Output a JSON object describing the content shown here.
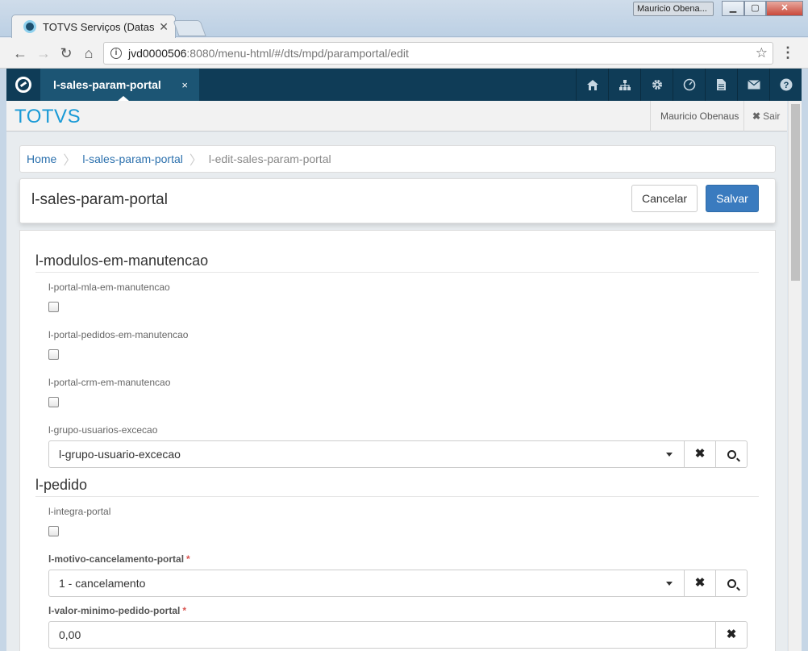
{
  "window": {
    "tab_title": "TOTVS Serviços (Datasul",
    "user_badge": "Mauricio Obena...",
    "min_label": "▁",
    "max_label": "▢",
    "close_label": "✕"
  },
  "address_bar": {
    "host": "jvd0000506",
    "path": ":8080/menu-html/#/dts/mpd/paramportal/edit"
  },
  "app": {
    "tab_label": "l-sales-param-portal",
    "tab_close": "×",
    "icons": [
      "home-icon",
      "sitemap-icon",
      "settings-icon",
      "dashboard-icon",
      "document-icon",
      "mail-icon",
      "help-icon"
    ],
    "brand": "TOTVS",
    "user": "Mauricio Obenaus",
    "logout": "Sair"
  },
  "breadcrumb": {
    "items": [
      "Home",
      "l-sales-param-portal",
      "l-edit-sales-param-portal"
    ]
  },
  "page": {
    "title": "l-sales-param-portal",
    "cancel_label": "Cancelar",
    "save_label": "Salvar"
  },
  "sections": {
    "maintenance": {
      "title": "l-modulos-em-manutencao",
      "mla_label": "l-portal-mla-em-manutencao",
      "mla_checked": false,
      "orders_label": "l-portal-pedidos-em-manutencao",
      "orders_checked": false,
      "crm_label": "l-portal-crm-em-manutencao",
      "crm_checked": false,
      "group_label": "l-grupo-usuarios-excecao",
      "group_value": "l-grupo-usuario-excecao"
    },
    "order": {
      "title": "l-pedido",
      "integrate_label": "l-integra-portal",
      "integrate_checked": false,
      "reason_label": "l-motivo-cancelamento-portal",
      "reason_value": "1 - cancelamento",
      "min_value_label": "l-valor-minimo-pedido-portal",
      "min_value": "0,00",
      "required_mark": "*"
    }
  },
  "colors": {
    "app_bar": "#0f3c57",
    "app_tab": "#1c5574",
    "brand": "#1a9ad6",
    "primary_button": "#3a7bbf",
    "link": "#2b70ad",
    "required": "#d9534f"
  }
}
